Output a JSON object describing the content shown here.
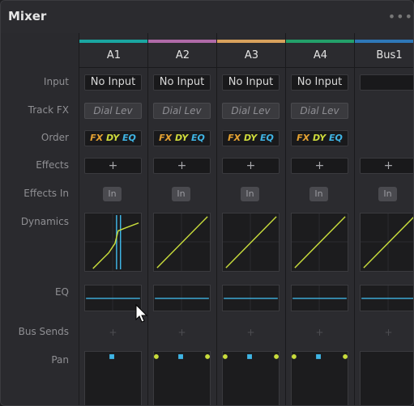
{
  "window": {
    "title": "Mixer"
  },
  "row_labels": [
    "Input",
    "Track FX",
    "Order",
    "Effects",
    "Effects In",
    "Dynamics",
    "EQ",
    "Bus Sends",
    "Pan"
  ],
  "channels": [
    {
      "name": "A1",
      "bar_color": "#1aa6a1",
      "input": "No Input",
      "track_fx": "Dial Lev",
      "order": [
        "FX",
        "DY",
        "EQ"
      ],
      "effects": "+",
      "effects_in": "In",
      "bus_sends": "+",
      "pan_dots": "center"
    },
    {
      "name": "A2",
      "bar_color": "#b06aa8",
      "input": "No Input",
      "track_fx": "Dial Lev",
      "order": [
        "FX",
        "DY",
        "EQ"
      ],
      "effects": "+",
      "effects_in": "In",
      "bus_sends": "+",
      "pan_dots": "stereo"
    },
    {
      "name": "A3",
      "bar_color": "#d8a15c",
      "input": "No Input",
      "track_fx": "Dial Lev",
      "order": [
        "FX",
        "DY",
        "EQ"
      ],
      "effects": "+",
      "effects_in": "In",
      "bus_sends": "+",
      "pan_dots": "stereo"
    },
    {
      "name": "A4",
      "bar_color": "#23a06a",
      "input": "No Input",
      "track_fx": "Dial Lev",
      "order": [
        "FX",
        "DY",
        "EQ"
      ],
      "effects": "+",
      "effects_in": "In",
      "bus_sends": "+",
      "pan_dots": "stereo"
    },
    {
      "name": "Bus1",
      "bar_color": "#2e78b8",
      "input": "",
      "track_fx": "",
      "order": [],
      "effects": "+",
      "effects_in": "In",
      "bus_sends": "+",
      "pan_dots": "none"
    }
  ],
  "colors": {
    "order_fx": "#e6a332",
    "order_dy": "#cfdc3c",
    "order_eq": "#3fb5e5",
    "curve": "#c8dc3c",
    "eq_line": "#3fb5e5"
  },
  "icons": {
    "menu": "more-dots-icon",
    "cursor": "mouse-pointer-icon"
  }
}
